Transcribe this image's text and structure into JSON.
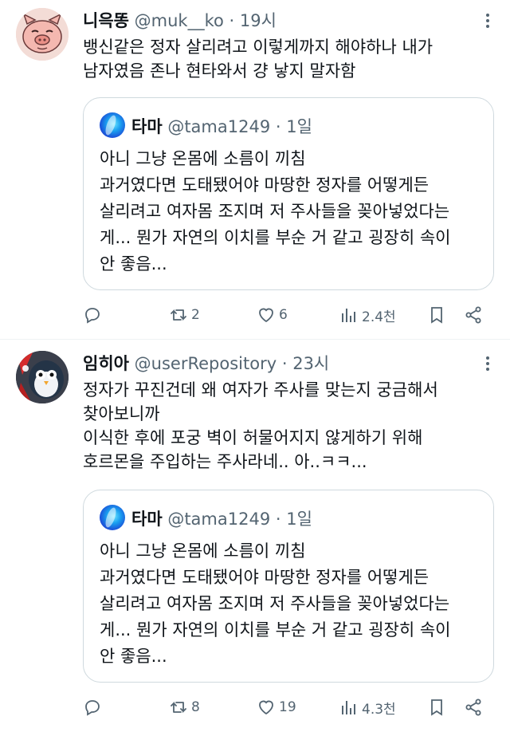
{
  "tweets": [
    {
      "name": "니윽똥",
      "handle": "@muk__ko",
      "time": "19시",
      "text": "뱅신같은 정자 살리려고 이렇게까지 해야하나 내가\n남자였음 존나 현타와서 걍 낳지 말자함",
      "quote": {
        "name": "타마",
        "handle": "@tama1249",
        "time": "1일",
        "text": "아니 그냥 온몸에 소름이 끼침\n과거였다면 도태됐어야 마땅한 정자를 어떻게든\n살리려고 여자몸 조지며 저 주사들을 꽂아넣었다는\n게... 뭔가 자연의 이치를 부순 거 같고 굉장히 속이\n안 좋음..."
      },
      "stats": {
        "reposts": "2",
        "likes": "6",
        "views": "2.4천"
      }
    },
    {
      "name": "임히아",
      "handle": "@userRepository",
      "time": "23시",
      "text": "정자가 꾸진건데 왜 여자가 주사를 맞는지 궁금해서\n찾아보니까\n이식한 후에 포궁 벽이 허물어지지 않게하기 위해\n호르몬을 주입하는 주사라네.. 아..ㅋㅋ...",
      "quote": {
        "name": "타마",
        "handle": "@tama1249",
        "time": "1일",
        "text": "아니 그냥 온몸에 소름이 끼침\n과거였다면 도태됐어야 마땅한 정자를 어떻게든\n살리려고 여자몸 조지며 저 주사들을 꽂아넣었다는\n게... 뭔가 자연의 이치를 부순 거 같고 굉장히 속이\n안 좋음..."
      },
      "stats": {
        "reposts": "8",
        "likes": "19",
        "views": "4.3천"
      }
    }
  ],
  "separator": "·",
  "colors": {
    "text": "#0f1419",
    "secondary": "#536471",
    "border": "#cfd9de"
  }
}
